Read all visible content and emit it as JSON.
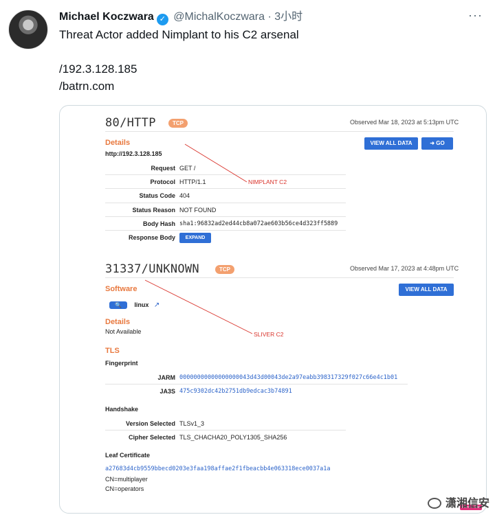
{
  "tweet": {
    "author_name": "Michael Koczwara",
    "handle": "@MichalKoczwara",
    "separator": "·",
    "time": "3小时",
    "more_icon": "more-dots-icon",
    "lines": [
      "Threat Actor added Nimplant to his C2 arsenal",
      "/192.3.128.185",
      "/batrn.com"
    ]
  },
  "card1": {
    "port": "80/HTTP",
    "proto_badge": "TCP",
    "observed": "Observed Mar 18, 2023 at 5:13pm UTC",
    "view_all_label": "VIEW ALL DATA",
    "go_label": "➜ GO",
    "details_heading": "Details",
    "url": "http://192.3.128.185",
    "rows": [
      {
        "label": "Request",
        "value": "GET /"
      },
      {
        "label": "Protocol",
        "value": "HTTP/1.1"
      },
      {
        "label": "Status Code",
        "value": "404"
      },
      {
        "label": "Status Reason",
        "value": "NOT FOUND"
      },
      {
        "label": "Body Hash",
        "value": "sha1:96832ad2ed44cb8a072ae603b56ce4d323ff5889"
      },
      {
        "label": "Response Body",
        "value": ""
      }
    ],
    "expand_label": "EXPAND",
    "annotation": "NIMPLANT C2"
  },
  "card2": {
    "port": "31337/UNKNOWN",
    "proto_badge": "TCP",
    "observed": "Observed Mar 17, 2023 at 4:48pm UTC",
    "view_all_label": "VIEW ALL DATA",
    "software_heading": "Software",
    "software_name": "linux",
    "details_heading": "Details",
    "details_value": "Not Available",
    "annotation": "SLIVER C2",
    "tls_heading": "TLS",
    "fingerprint_heading": "Fingerprint",
    "fingerprint": [
      {
        "label": "JARM",
        "value": "00000000000000000043d43d00043de2a97eabb398317329f027c66e4c1b01"
      },
      {
        "label": "JA3S",
        "value": "475c9302dc42b2751db9edcac3b74891"
      }
    ],
    "handshake_heading": "Handshake",
    "handshake": [
      {
        "label": "Version Selected",
        "value": "TLSv1_3"
      },
      {
        "label": "Cipher Selected",
        "value": "TLS_CHACHA20_POLY1305_SHA256"
      }
    ],
    "leaf_heading": "Leaf Certificate",
    "leaf_hash": "a27683d4cb9559bbecd0203e3faa198affae2f1fbeacbb4e063318ece0037a1a",
    "cn1": "CN=multiplayer",
    "cn2": "CN=operators"
  },
  "watermark": {
    "text": "潇湘信安",
    "icon": "wechat-icon",
    "badge": "Point X Site"
  },
  "colors": {
    "accent_orange": "#e8783e",
    "button_blue": "#2f6fd6",
    "annotation_red": "#d9332b",
    "verified_blue": "#1d9bf0"
  }
}
